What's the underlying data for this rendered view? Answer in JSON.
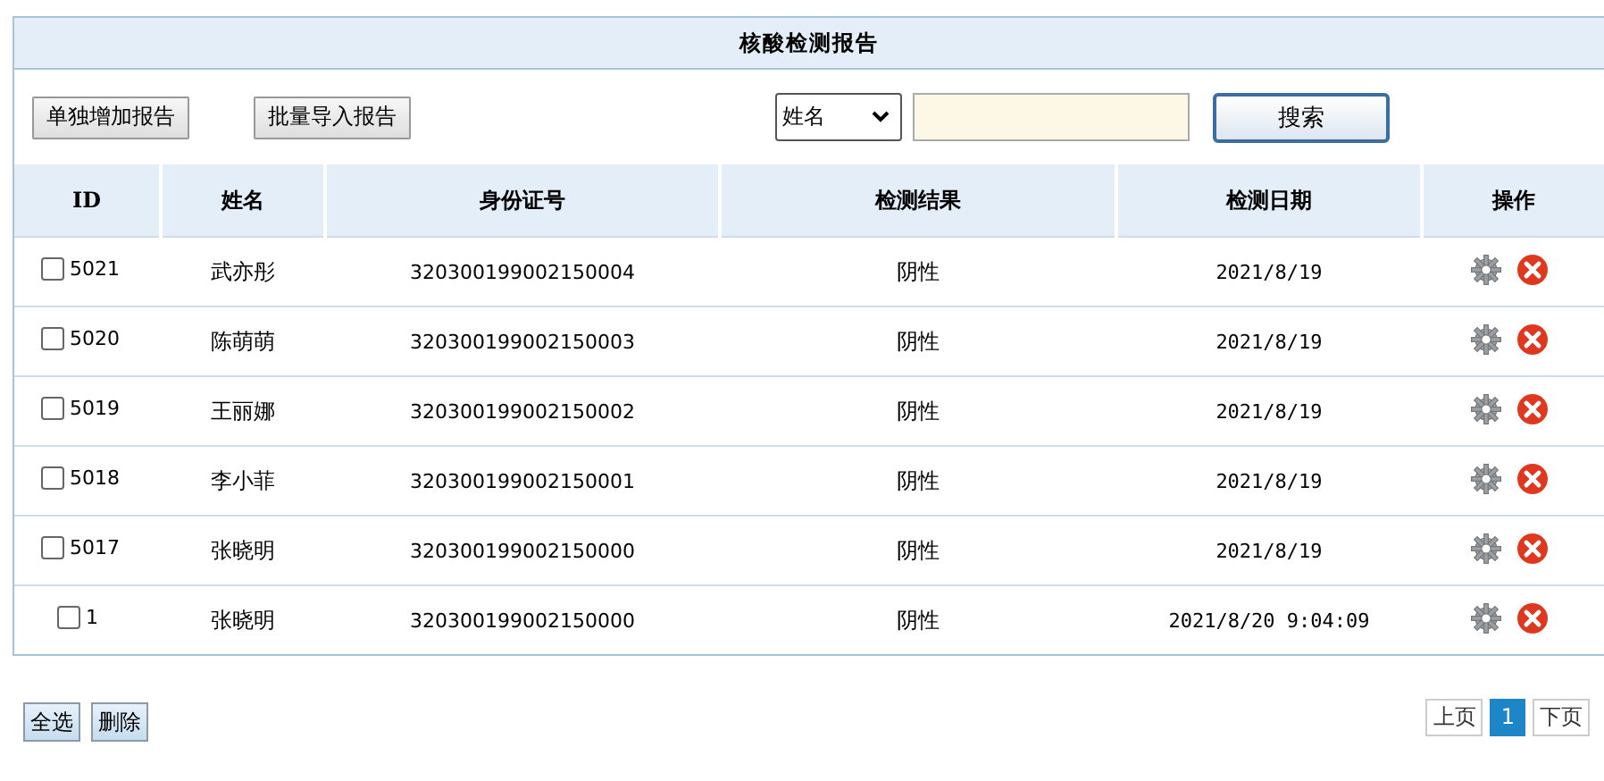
{
  "panel": {
    "title": "核酸检测报告"
  },
  "toolbar": {
    "buttons": [
      "单独增加报告",
      "批量导入报告"
    ],
    "search_field": {
      "value": "姓名"
    },
    "search_button": "搜索"
  },
  "table": {
    "columns": [
      "ID",
      "姓名",
      "身份证号",
      "检测结果",
      "检测日期",
      "操作"
    ],
    "rows": [
      {
        "id": "5021",
        "checked": false,
        "name": "武亦彤",
        "id_number": "320300199002150004",
        "result": "阴性",
        "date": "2021/8/19"
      },
      {
        "id": "5020",
        "checked": false,
        "name": "陈萌萌",
        "id_number": "320300199002150003",
        "result": "阴性",
        "date": "2021/8/19"
      },
      {
        "id": "5019",
        "checked": false,
        "name": "王丽娜",
        "id_number": "320300199002150002",
        "result": "阴性",
        "date": "2021/8/19"
      },
      {
        "id": "5018",
        "checked": false,
        "name": "李小菲",
        "id_number": "320300199002150001",
        "result": "阴性",
        "date": "2021/8/19"
      },
      {
        "id": "5017",
        "checked": false,
        "name": "张晓明",
        "id_number": "320300199002150000",
        "result": "阴性",
        "date": "2021/8/19"
      },
      {
        "id": "1",
        "checked": false,
        "name": "张晓明",
        "id_number": "320300199002150000",
        "result": "阴性",
        "date": "2021/8/20 9:04:09"
      }
    ]
  },
  "footer": {
    "buttons": [
      "全选",
      "删除"
    ],
    "pagination": [
      {
        "label": "上页",
        "selected": false
      },
      {
        "label": "1",
        "selected": true
      },
      {
        "label": "下页",
        "selected": false
      }
    ]
  }
}
